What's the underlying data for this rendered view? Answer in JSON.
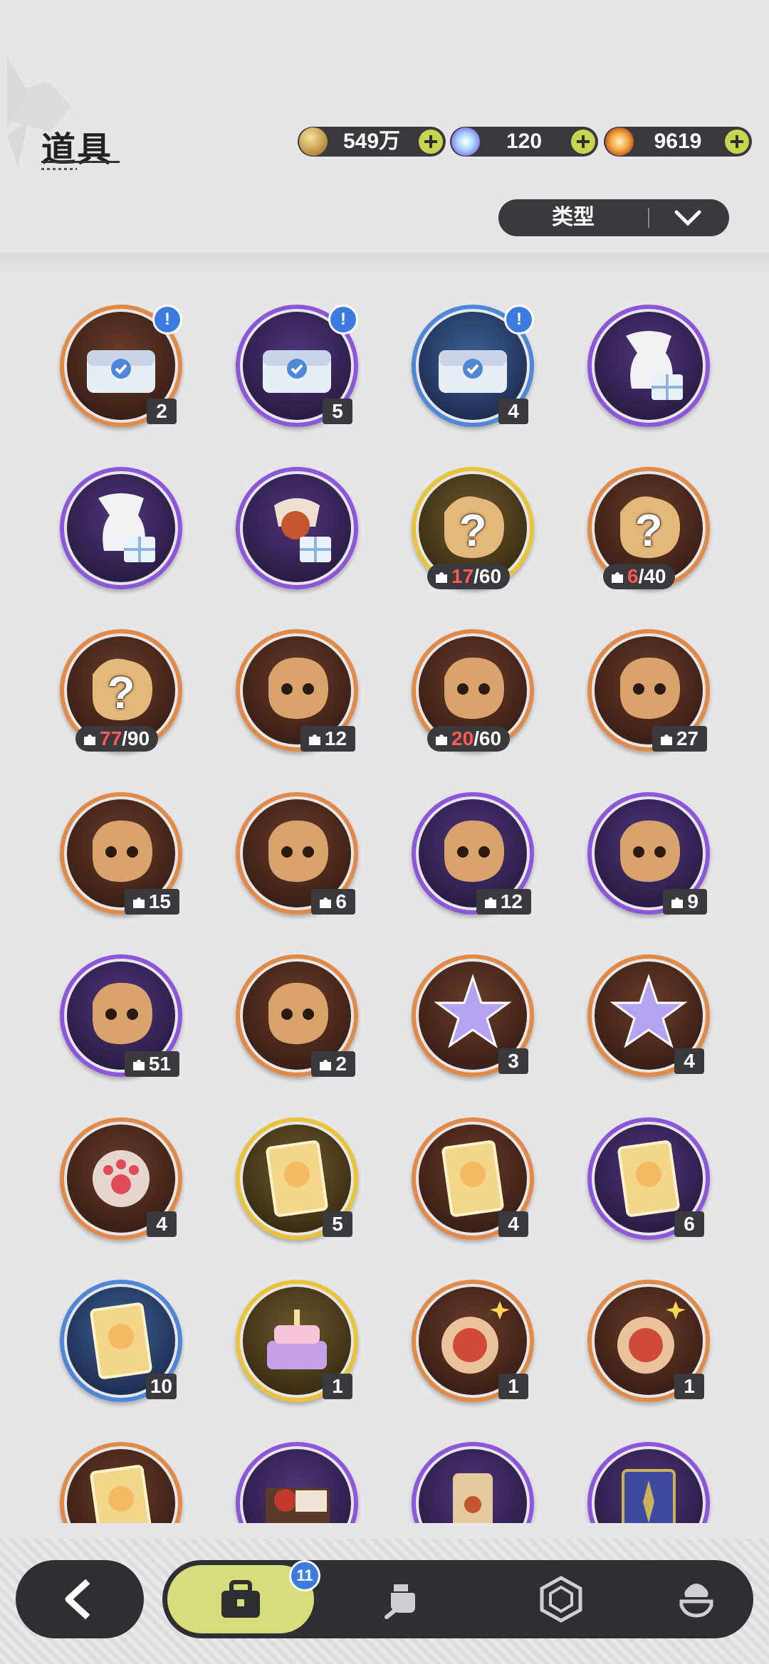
{
  "header": {
    "title": "道具",
    "currencies": [
      {
        "name": "gold-coin-icon",
        "value": "549万"
      },
      {
        "name": "crystal-icon",
        "value": "120"
      },
      {
        "name": "star-gem-icon",
        "value": "9619"
      }
    ],
    "filter": {
      "label": "类型"
    }
  },
  "colors": {
    "orange_ring": "#e08a4a",
    "purple_ring": "#8c56d8",
    "blue_ring": "#4f86d6",
    "gold_ring": "#e9c43a",
    "accent": "#d7dd7a",
    "alert": "#3d7be0"
  },
  "items": [
    {
      "icon": "chest-icon",
      "rarity": "orange",
      "count": "2",
      "alert": "!"
    },
    {
      "icon": "chest-icon",
      "rarity": "purple",
      "count": "5",
      "alert": "!"
    },
    {
      "icon": "chest-icon",
      "rarity": "blue",
      "count": "4",
      "alert": "!"
    },
    {
      "icon": "gift-bag-icon",
      "rarity": "purple"
    },
    {
      "icon": "gift-bag-icon",
      "rarity": "purple"
    },
    {
      "icon": "gift-pack-icon",
      "rarity": "purple"
    },
    {
      "icon": "mystery-fragment-icon",
      "rarity": "gold",
      "frag_cur": "17",
      "frag_max": "/60"
    },
    {
      "icon": "mystery-fragment-icon",
      "rarity": "orange",
      "frag_cur": "6",
      "frag_max": "/40"
    },
    {
      "icon": "mystery-fragment-icon",
      "rarity": "orange",
      "frag_cur": "77",
      "frag_max": "/90"
    },
    {
      "icon": "pet-fragment-icon",
      "rarity": "orange",
      "frag_count": "12"
    },
    {
      "icon": "pet-fragment-icon",
      "rarity": "orange",
      "frag_cur": "20",
      "frag_max": "/60"
    },
    {
      "icon": "pet-fragment-icon",
      "rarity": "orange",
      "frag_count": "27"
    },
    {
      "icon": "pet-fragment-icon",
      "rarity": "orange",
      "frag_count": "15"
    },
    {
      "icon": "pet-fragment-icon",
      "rarity": "orange",
      "frag_count": "6"
    },
    {
      "icon": "pet-fragment-icon",
      "rarity": "purple",
      "frag_count": "12"
    },
    {
      "icon": "pet-fragment-icon",
      "rarity": "purple",
      "frag_count": "9"
    },
    {
      "icon": "pet-fragment-icon",
      "rarity": "purple",
      "frag_count": "51"
    },
    {
      "icon": "pet-fragment-icon",
      "rarity": "orange",
      "frag_count": "2"
    },
    {
      "icon": "crystal-star-icon",
      "rarity": "orange",
      "count": "3"
    },
    {
      "icon": "crystal-star-icon",
      "rarity": "orange",
      "count": "4"
    },
    {
      "icon": "paw-orb-icon",
      "rarity": "orange",
      "count": "4"
    },
    {
      "icon": "card-icon",
      "rarity": "gold",
      "count": "5"
    },
    {
      "icon": "card-icon",
      "rarity": "orange",
      "count": "4"
    },
    {
      "icon": "card-icon",
      "rarity": "purple",
      "count": "6"
    },
    {
      "icon": "card-icon",
      "rarity": "blue",
      "count": "10"
    },
    {
      "icon": "cake-icon",
      "rarity": "gold",
      "count": "1"
    },
    {
      "icon": "firework-bomb-icon",
      "rarity": "orange",
      "count": "1"
    },
    {
      "icon": "firework-bomb-icon",
      "rarity": "orange",
      "count": "1"
    },
    {
      "icon": "card-icon",
      "rarity": "orange"
    },
    {
      "icon": "chocolate-box-icon",
      "rarity": "purple"
    },
    {
      "icon": "scroll-icon",
      "rarity": "purple"
    },
    {
      "icon": "book-icon",
      "rarity": "purple"
    }
  ],
  "nav": {
    "back": "back-arrow-icon",
    "tabs": [
      {
        "icon": "bag-icon",
        "badge": "11",
        "active": true
      },
      {
        "icon": "cat-sword-icon"
      },
      {
        "icon": "hexagon-gem-icon"
      },
      {
        "icon": "pudding-icon"
      }
    ]
  }
}
